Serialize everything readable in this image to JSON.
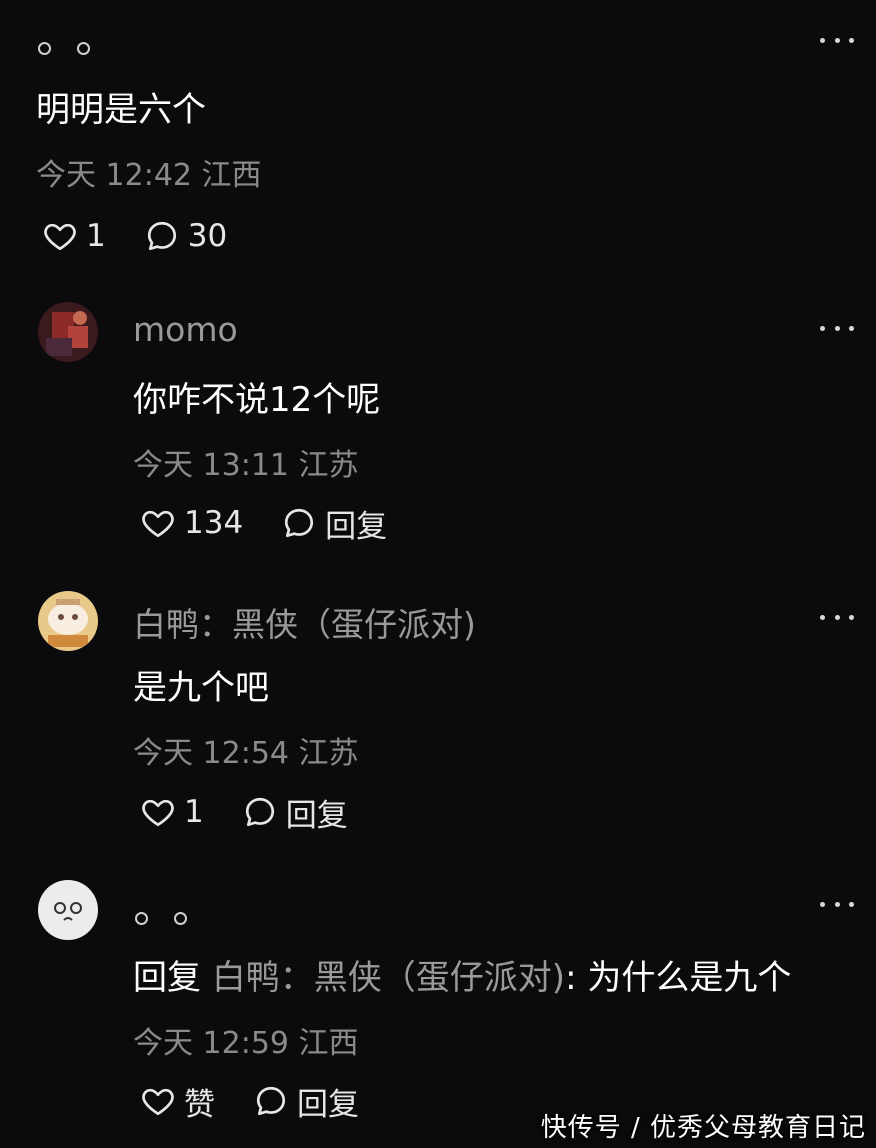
{
  "comments": [
    {
      "name": "。。",
      "text": "明明是六个",
      "time": "今天 12:42 江西",
      "likes": "1",
      "replies": "30"
    },
    {
      "name": "momo",
      "text": "你咋不说12个呢",
      "time": "今天 13:11 江苏",
      "likes": "134",
      "reply_label": "回复"
    },
    {
      "name": "白鸭：黑侠（蛋仔派对)",
      "text": "是九个吧",
      "time": "今天 12:54 江苏",
      "likes": "1",
      "reply_label": "回复"
    },
    {
      "name": "。。",
      "reply_prefix": "回复",
      "reply_target": "白鸭：黑侠（蛋仔派对)",
      "reply_text": ": 为什么是九个",
      "time": "今天 12:59 江西",
      "like_label": "赞",
      "reply_label": "回复"
    }
  ],
  "watermark": "快传号 / 优秀父母教育日记",
  "icons": {
    "like": "heart-outline-icon",
    "comment": "speech-bubble-icon",
    "more": "more-dots-icon"
  },
  "colors": {
    "background": "#0b0b0d",
    "text": "#ffffff",
    "muted": "#8a8a8a"
  }
}
